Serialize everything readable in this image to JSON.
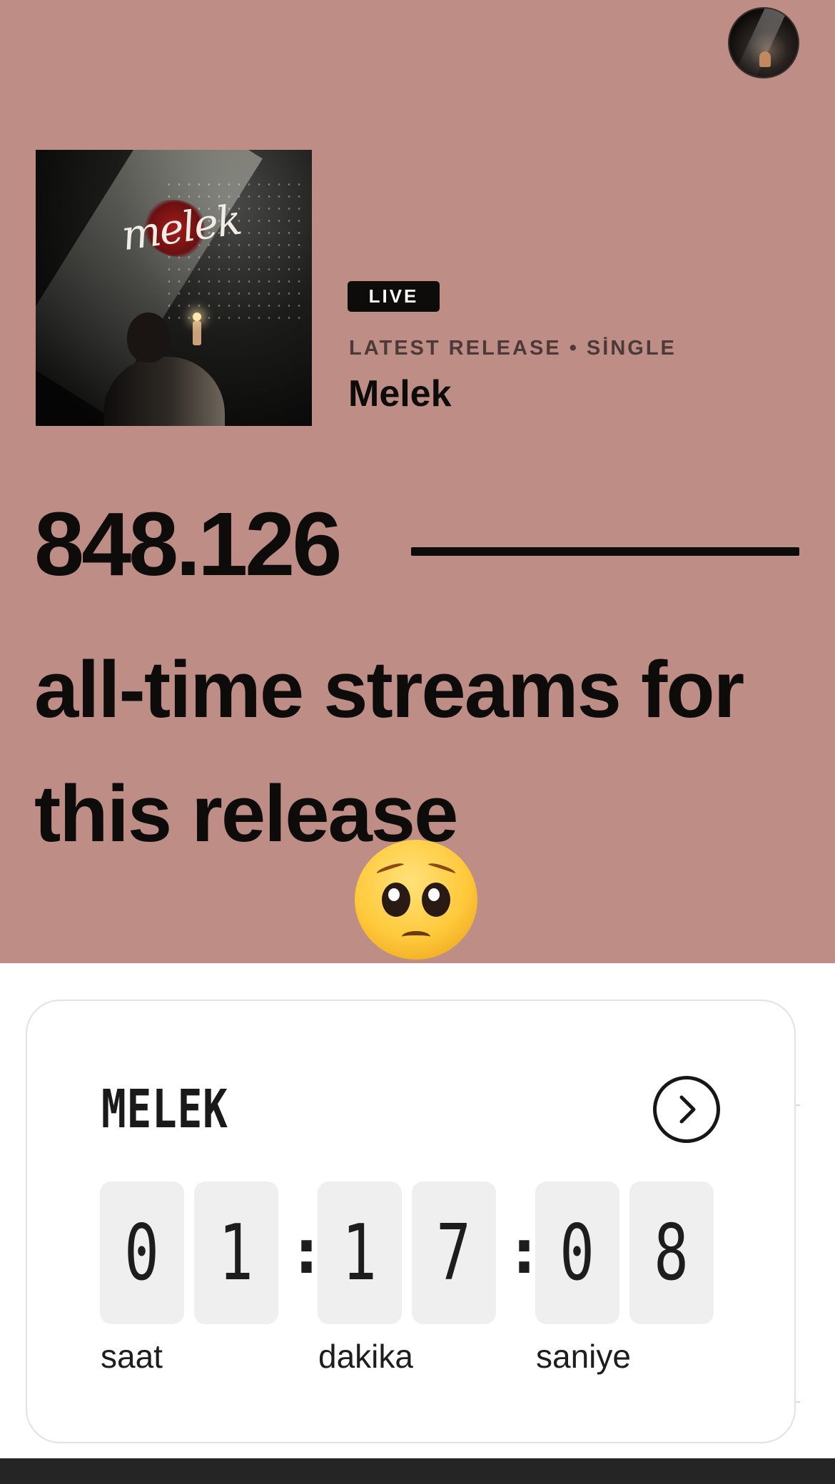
{
  "release": {
    "badge": "LIVE",
    "meta": "LATEST RELEASE • SİNGLE",
    "title": "Melek",
    "cover_title": "melek"
  },
  "stats": {
    "streams": "848.126",
    "caption": "all-time streams for this release",
    "emoji": "pleading-face"
  },
  "countdown": {
    "title": "MELEK",
    "hours": [
      "0",
      "1"
    ],
    "minutes": [
      "1",
      "7"
    ],
    "seconds": [
      "0",
      "8"
    ],
    "separator": ":",
    "units": {
      "hours": "saat",
      "minutes": "dakika",
      "seconds": "saniye"
    }
  },
  "colors": {
    "hero_bg": "#bd8d86",
    "text": "#0e0b0b",
    "digit_bg": "#efefef"
  },
  "icons": {
    "avatar": "profile-avatar",
    "next": "chevron-right-circle-icon"
  }
}
